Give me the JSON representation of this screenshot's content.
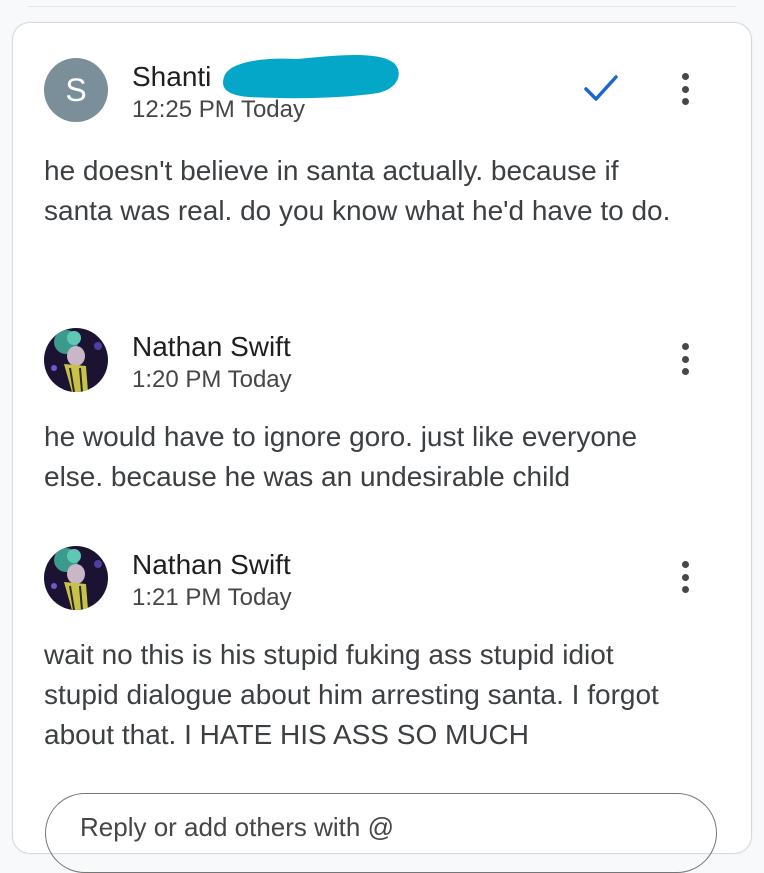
{
  "comments": [
    {
      "avatar_letter": "S",
      "author": "Shanti",
      "time": "12:25 PM Today",
      "body": "he doesn't believe in santa actually. because if santa was real. do you know what he'd have to do.",
      "resolved_icon": "check-icon",
      "menu_icon": "more-vert-icon"
    },
    {
      "author": "Nathan Swift",
      "time": "1:20 PM Today",
      "body": "he would have to ignore goro. just like everyone else. because he was an undesirable child",
      "menu_icon": "more-vert-icon"
    },
    {
      "author": "Nathan Swift",
      "time": "1:21 PM Today",
      "body": "wait no this is his stupid fuking ass stupid idiot stupid dialogue about him arresting santa. I forgot about that. I HATE HIS ASS SO MUCH",
      "menu_icon": "more-vert-icon"
    }
  ],
  "reply": {
    "placeholder": "Reply or add others with @"
  },
  "colors": {
    "accent": "#1a67d2",
    "redaction": "#05a7c9",
    "avatar_letter_bg": "#7b8f9a"
  }
}
